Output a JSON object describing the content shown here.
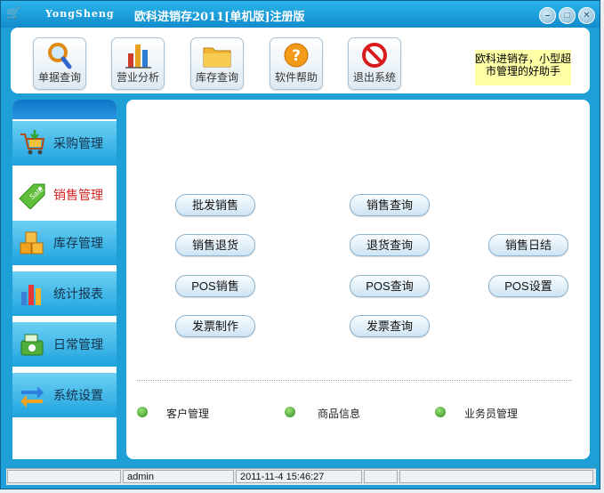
{
  "window": {
    "brand": "YongSheng",
    "title": "欧科进销存2011[单机版]注册版",
    "controls": [
      "minimize",
      "maximize",
      "close"
    ]
  },
  "toolbar": {
    "buttons": [
      {
        "label": "单据查询",
        "icon": "search-magnifier-icon"
      },
      {
        "label": "营业分析",
        "icon": "bar-chart-icon"
      },
      {
        "label": "库存查询",
        "icon": "folder-icon"
      },
      {
        "label": "软件帮助",
        "icon": "help-icon"
      },
      {
        "label": "退出系统",
        "icon": "no-entry-icon"
      }
    ],
    "note": "欧科进销存，小型超市管理的好助手"
  },
  "sidebar": {
    "items": [
      {
        "label": "采购管理",
        "icon": "shopping-cart-icon",
        "active": false
      },
      {
        "label": "销售管理",
        "icon": "sale-tag-icon",
        "active": true
      },
      {
        "label": "库存管理",
        "icon": "boxes-icon",
        "active": false
      },
      {
        "label": "统计报表",
        "icon": "report-chart-icon",
        "active": false
      },
      {
        "label": "日常管理",
        "icon": "cash-register-icon",
        "active": false
      },
      {
        "label": "系统设置",
        "icon": "swap-arrows-icon",
        "active": false
      }
    ]
  },
  "main": {
    "actions": {
      "wholesale": "批发销售",
      "sales_query": "销售查询",
      "sales_return": "销售退货",
      "return_query": "退货查询",
      "daily_settle": "销售日结",
      "pos_sales": "POS销售",
      "pos_query": "POS查询",
      "pos_settings": "POS设置",
      "invoice_make": "发票制作",
      "invoice_query": "发票查询"
    },
    "links": {
      "customer": "客户管理",
      "product": "商品信息",
      "salesperson": "业务员管理"
    }
  },
  "status": {
    "user": "admin",
    "datetime": "2011-11-4 15:46:27"
  },
  "colors": {
    "frame": "#1e9fd6",
    "sidebar_item": "#3bb6ea",
    "active_label": "#d42424",
    "note_bg": "#ffffa8"
  }
}
